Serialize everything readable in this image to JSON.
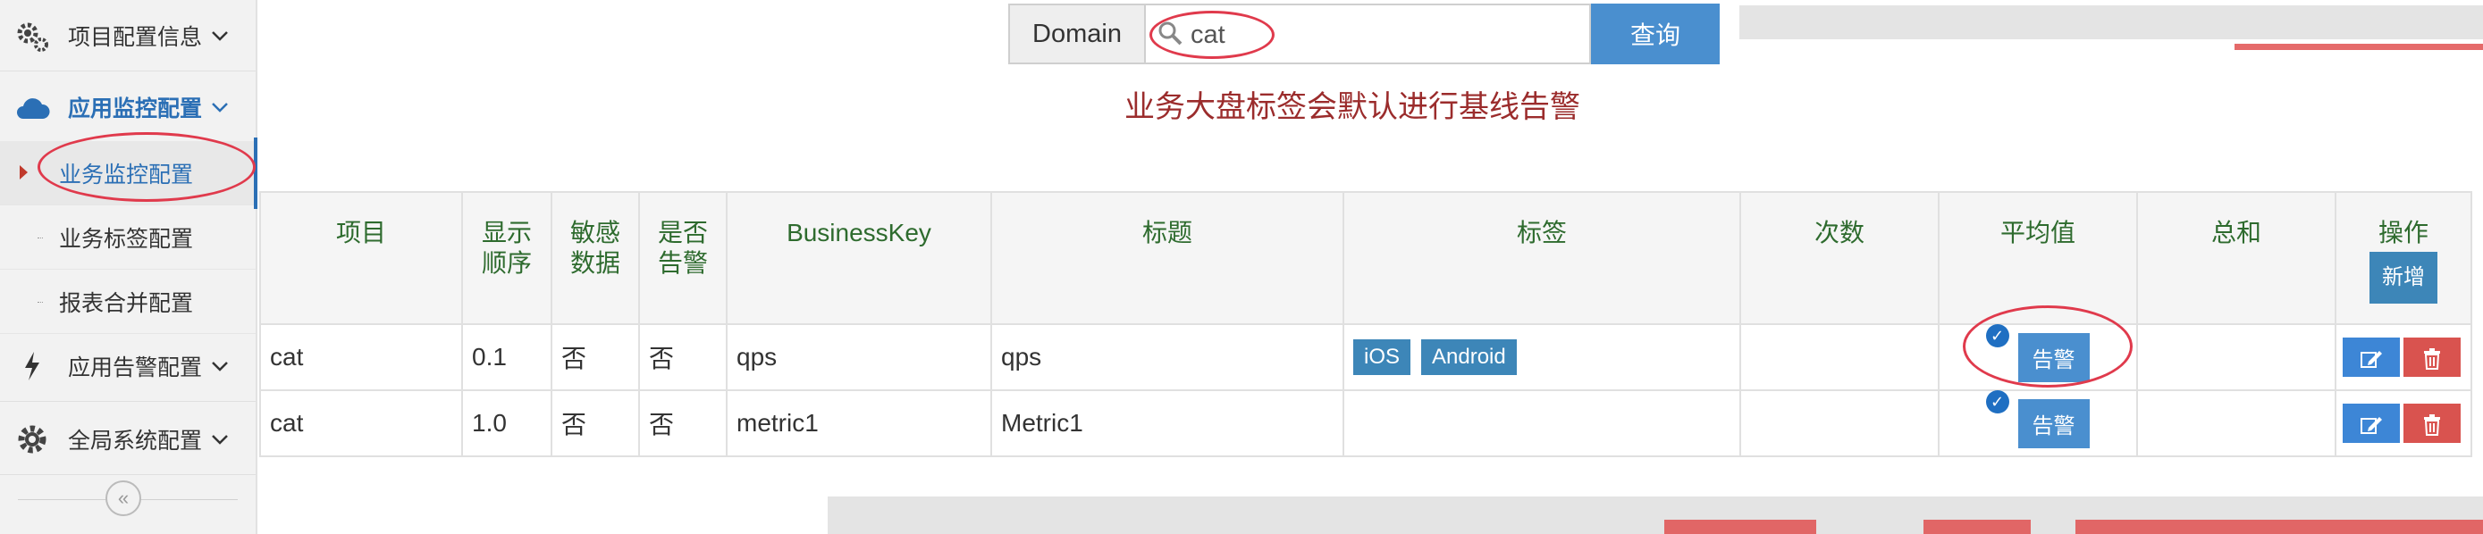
{
  "sidebar": {
    "groups": [
      {
        "label": "项目配置信息",
        "icon": "gears-icon"
      },
      {
        "label": "应用监控配置",
        "icon": "cloud-icon"
      },
      {
        "label": "应用告警配置",
        "icon": "bolt-icon"
      },
      {
        "label": "全局系统配置",
        "icon": "gear-icon"
      }
    ],
    "subitems": [
      {
        "label": "业务监控配置"
      },
      {
        "label": "业务标签配置"
      },
      {
        "label": "报表合并配置"
      }
    ],
    "collapse_icon": "«"
  },
  "search": {
    "addon_label": "Domain",
    "value": "cat",
    "button_label": "查询"
  },
  "notice": "业务大盘标签会默认进行基线告警",
  "table": {
    "headers": {
      "project": "项目",
      "order": "显示顺序",
      "sensitive": "敏感数据",
      "alert": "是否告警",
      "business_key": "BusinessKey",
      "title": "标题",
      "tags": "标签",
      "count": "次数",
      "avg": "平均值",
      "sum": "总和",
      "ops": "操作"
    },
    "add_button": "新增",
    "rows": [
      {
        "project": "cat",
        "order": "0.1",
        "sensitive": "否",
        "alert": "否",
        "business_key": "qps",
        "title": "qps",
        "tags": [
          "iOS",
          "Android"
        ],
        "avg_alert": "告警"
      },
      {
        "project": "cat",
        "order": "1.0",
        "sensitive": "否",
        "alert": "否",
        "business_key": "metric1",
        "title": "Metric1",
        "tags": [],
        "avg_alert": "告警"
      }
    ]
  },
  "colors": {
    "accent": "#4a8fcf",
    "annotation": "#e03a4c",
    "notice": "#9b2c2c"
  }
}
